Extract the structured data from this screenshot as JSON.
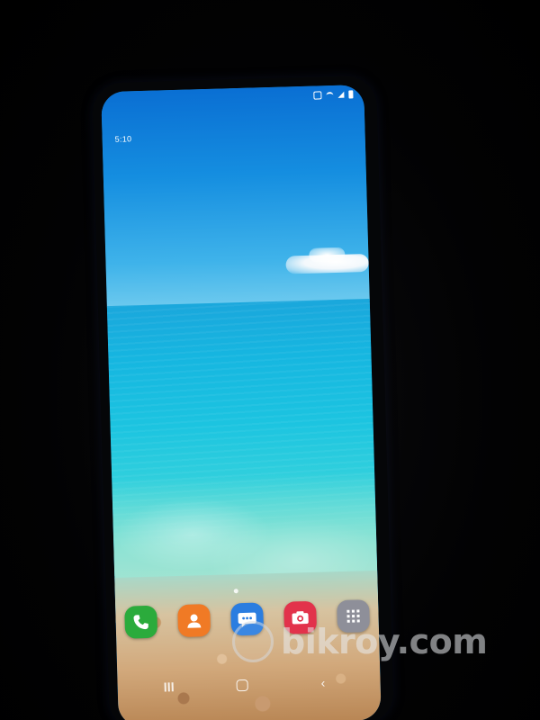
{
  "status_bar": {
    "time": "5:10",
    "icons": [
      "mute-icon",
      "wifi-icon",
      "signal-icon",
      "battery-icon"
    ]
  },
  "wallpaper": {
    "description_colors": {
      "sky": "#158ee0",
      "sea": "#1cc4e0",
      "sand": "#d2a97c"
    }
  },
  "home_screen": {
    "page_indicator": {
      "current": 1,
      "total": 1
    },
    "dock": [
      {
        "name": "phone",
        "icon": "phone-icon",
        "color": "#2bab3c"
      },
      {
        "name": "contacts",
        "icon": "contacts-icon",
        "color": "#f07a25"
      },
      {
        "name": "messages",
        "icon": "messages-icon",
        "color": "#2a7de0"
      },
      {
        "name": "camera",
        "icon": "camera-icon",
        "color": "#e2324b"
      },
      {
        "name": "apps",
        "icon": "apps-grid-icon",
        "color": "#8e8f99"
      }
    ]
  },
  "navigation_bar": {
    "buttons": [
      "recent-apps-icon",
      "home-icon",
      "back-icon"
    ],
    "back_glyph": "‹"
  },
  "watermark": {
    "text": "bikroy.com"
  }
}
